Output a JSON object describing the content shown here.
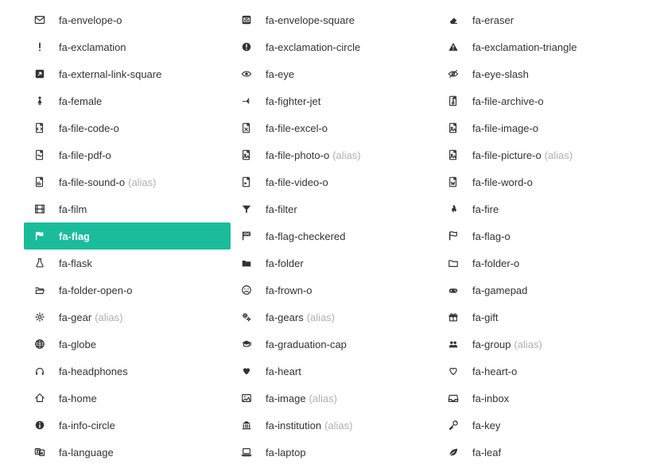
{
  "alias_text": "(alias)",
  "columns": [
    [
      {
        "id": "envelope-o",
        "label": "fa-envelope-o",
        "alias": false
      },
      {
        "id": "exclamation",
        "label": "fa-exclamation",
        "alias": false
      },
      {
        "id": "external-link-square",
        "label": "fa-external-link-square",
        "alias": false
      },
      {
        "id": "female",
        "label": "fa-female",
        "alias": false
      },
      {
        "id": "file-code-o",
        "label": "fa-file-code-o",
        "alias": false
      },
      {
        "id": "file-pdf-o",
        "label": "fa-file-pdf-o",
        "alias": false
      },
      {
        "id": "file-sound-o",
        "label": "fa-file-sound-o",
        "alias": true
      },
      {
        "id": "film",
        "label": "fa-film",
        "alias": false
      },
      {
        "id": "flag",
        "label": "fa-flag",
        "alias": false,
        "selected": true
      },
      {
        "id": "flask",
        "label": "fa-flask",
        "alias": false
      },
      {
        "id": "folder-open-o",
        "label": "fa-folder-open-o",
        "alias": false
      },
      {
        "id": "gear",
        "label": "fa-gear",
        "alias": true
      },
      {
        "id": "globe",
        "label": "fa-globe",
        "alias": false
      },
      {
        "id": "headphones",
        "label": "fa-headphones",
        "alias": false
      },
      {
        "id": "home",
        "label": "fa-home",
        "alias": false
      },
      {
        "id": "info-circle",
        "label": "fa-info-circle",
        "alias": false
      },
      {
        "id": "language",
        "label": "fa-language",
        "alias": false
      }
    ],
    [
      {
        "id": "envelope-square",
        "label": "fa-envelope-square",
        "alias": false
      },
      {
        "id": "exclamation-circle",
        "label": "fa-exclamation-circle",
        "alias": false
      },
      {
        "id": "eye",
        "label": "fa-eye",
        "alias": false
      },
      {
        "id": "fighter-jet",
        "label": "fa-fighter-jet",
        "alias": false
      },
      {
        "id": "file-excel-o",
        "label": "fa-file-excel-o",
        "alias": false
      },
      {
        "id": "file-photo-o",
        "label": "fa-file-photo-o",
        "alias": true
      },
      {
        "id": "file-video-o",
        "label": "fa-file-video-o",
        "alias": false
      },
      {
        "id": "filter",
        "label": "fa-filter",
        "alias": false
      },
      {
        "id": "flag-checkered",
        "label": "fa-flag-checkered",
        "alias": false
      },
      {
        "id": "folder",
        "label": "fa-folder",
        "alias": false
      },
      {
        "id": "frown-o",
        "label": "fa-frown-o",
        "alias": false
      },
      {
        "id": "gears",
        "label": "fa-gears",
        "alias": true
      },
      {
        "id": "graduation-cap",
        "label": "fa-graduation-cap",
        "alias": false
      },
      {
        "id": "heart",
        "label": "fa-heart",
        "alias": false
      },
      {
        "id": "image",
        "label": "fa-image",
        "alias": true
      },
      {
        "id": "institution",
        "label": "fa-institution",
        "alias": true
      },
      {
        "id": "laptop",
        "label": "fa-laptop",
        "alias": false
      }
    ],
    [
      {
        "id": "eraser",
        "label": "fa-eraser",
        "alias": false
      },
      {
        "id": "exclamation-triangle",
        "label": "fa-exclamation-triangle",
        "alias": false
      },
      {
        "id": "eye-slash",
        "label": "fa-eye-slash",
        "alias": false
      },
      {
        "id": "file-archive-o",
        "label": "fa-file-archive-o",
        "alias": false
      },
      {
        "id": "file-image-o",
        "label": "fa-file-image-o",
        "alias": false
      },
      {
        "id": "file-picture-o",
        "label": "fa-file-picture-o",
        "alias": true
      },
      {
        "id": "file-word-o",
        "label": "fa-file-word-o",
        "alias": false
      },
      {
        "id": "fire",
        "label": "fa-fire",
        "alias": false
      },
      {
        "id": "flag-o",
        "label": "fa-flag-o",
        "alias": false
      },
      {
        "id": "folder-o",
        "label": "fa-folder-o",
        "alias": false
      },
      {
        "id": "gamepad",
        "label": "fa-gamepad",
        "alias": false
      },
      {
        "id": "gift",
        "label": "fa-gift",
        "alias": false
      },
      {
        "id": "group",
        "label": "fa-group",
        "alias": true
      },
      {
        "id": "heart-o",
        "label": "fa-heart-o",
        "alias": false
      },
      {
        "id": "inbox",
        "label": "fa-inbox",
        "alias": false
      },
      {
        "id": "key",
        "label": "fa-key",
        "alias": false
      },
      {
        "id": "leaf",
        "label": "fa-leaf",
        "alias": false
      }
    ]
  ]
}
